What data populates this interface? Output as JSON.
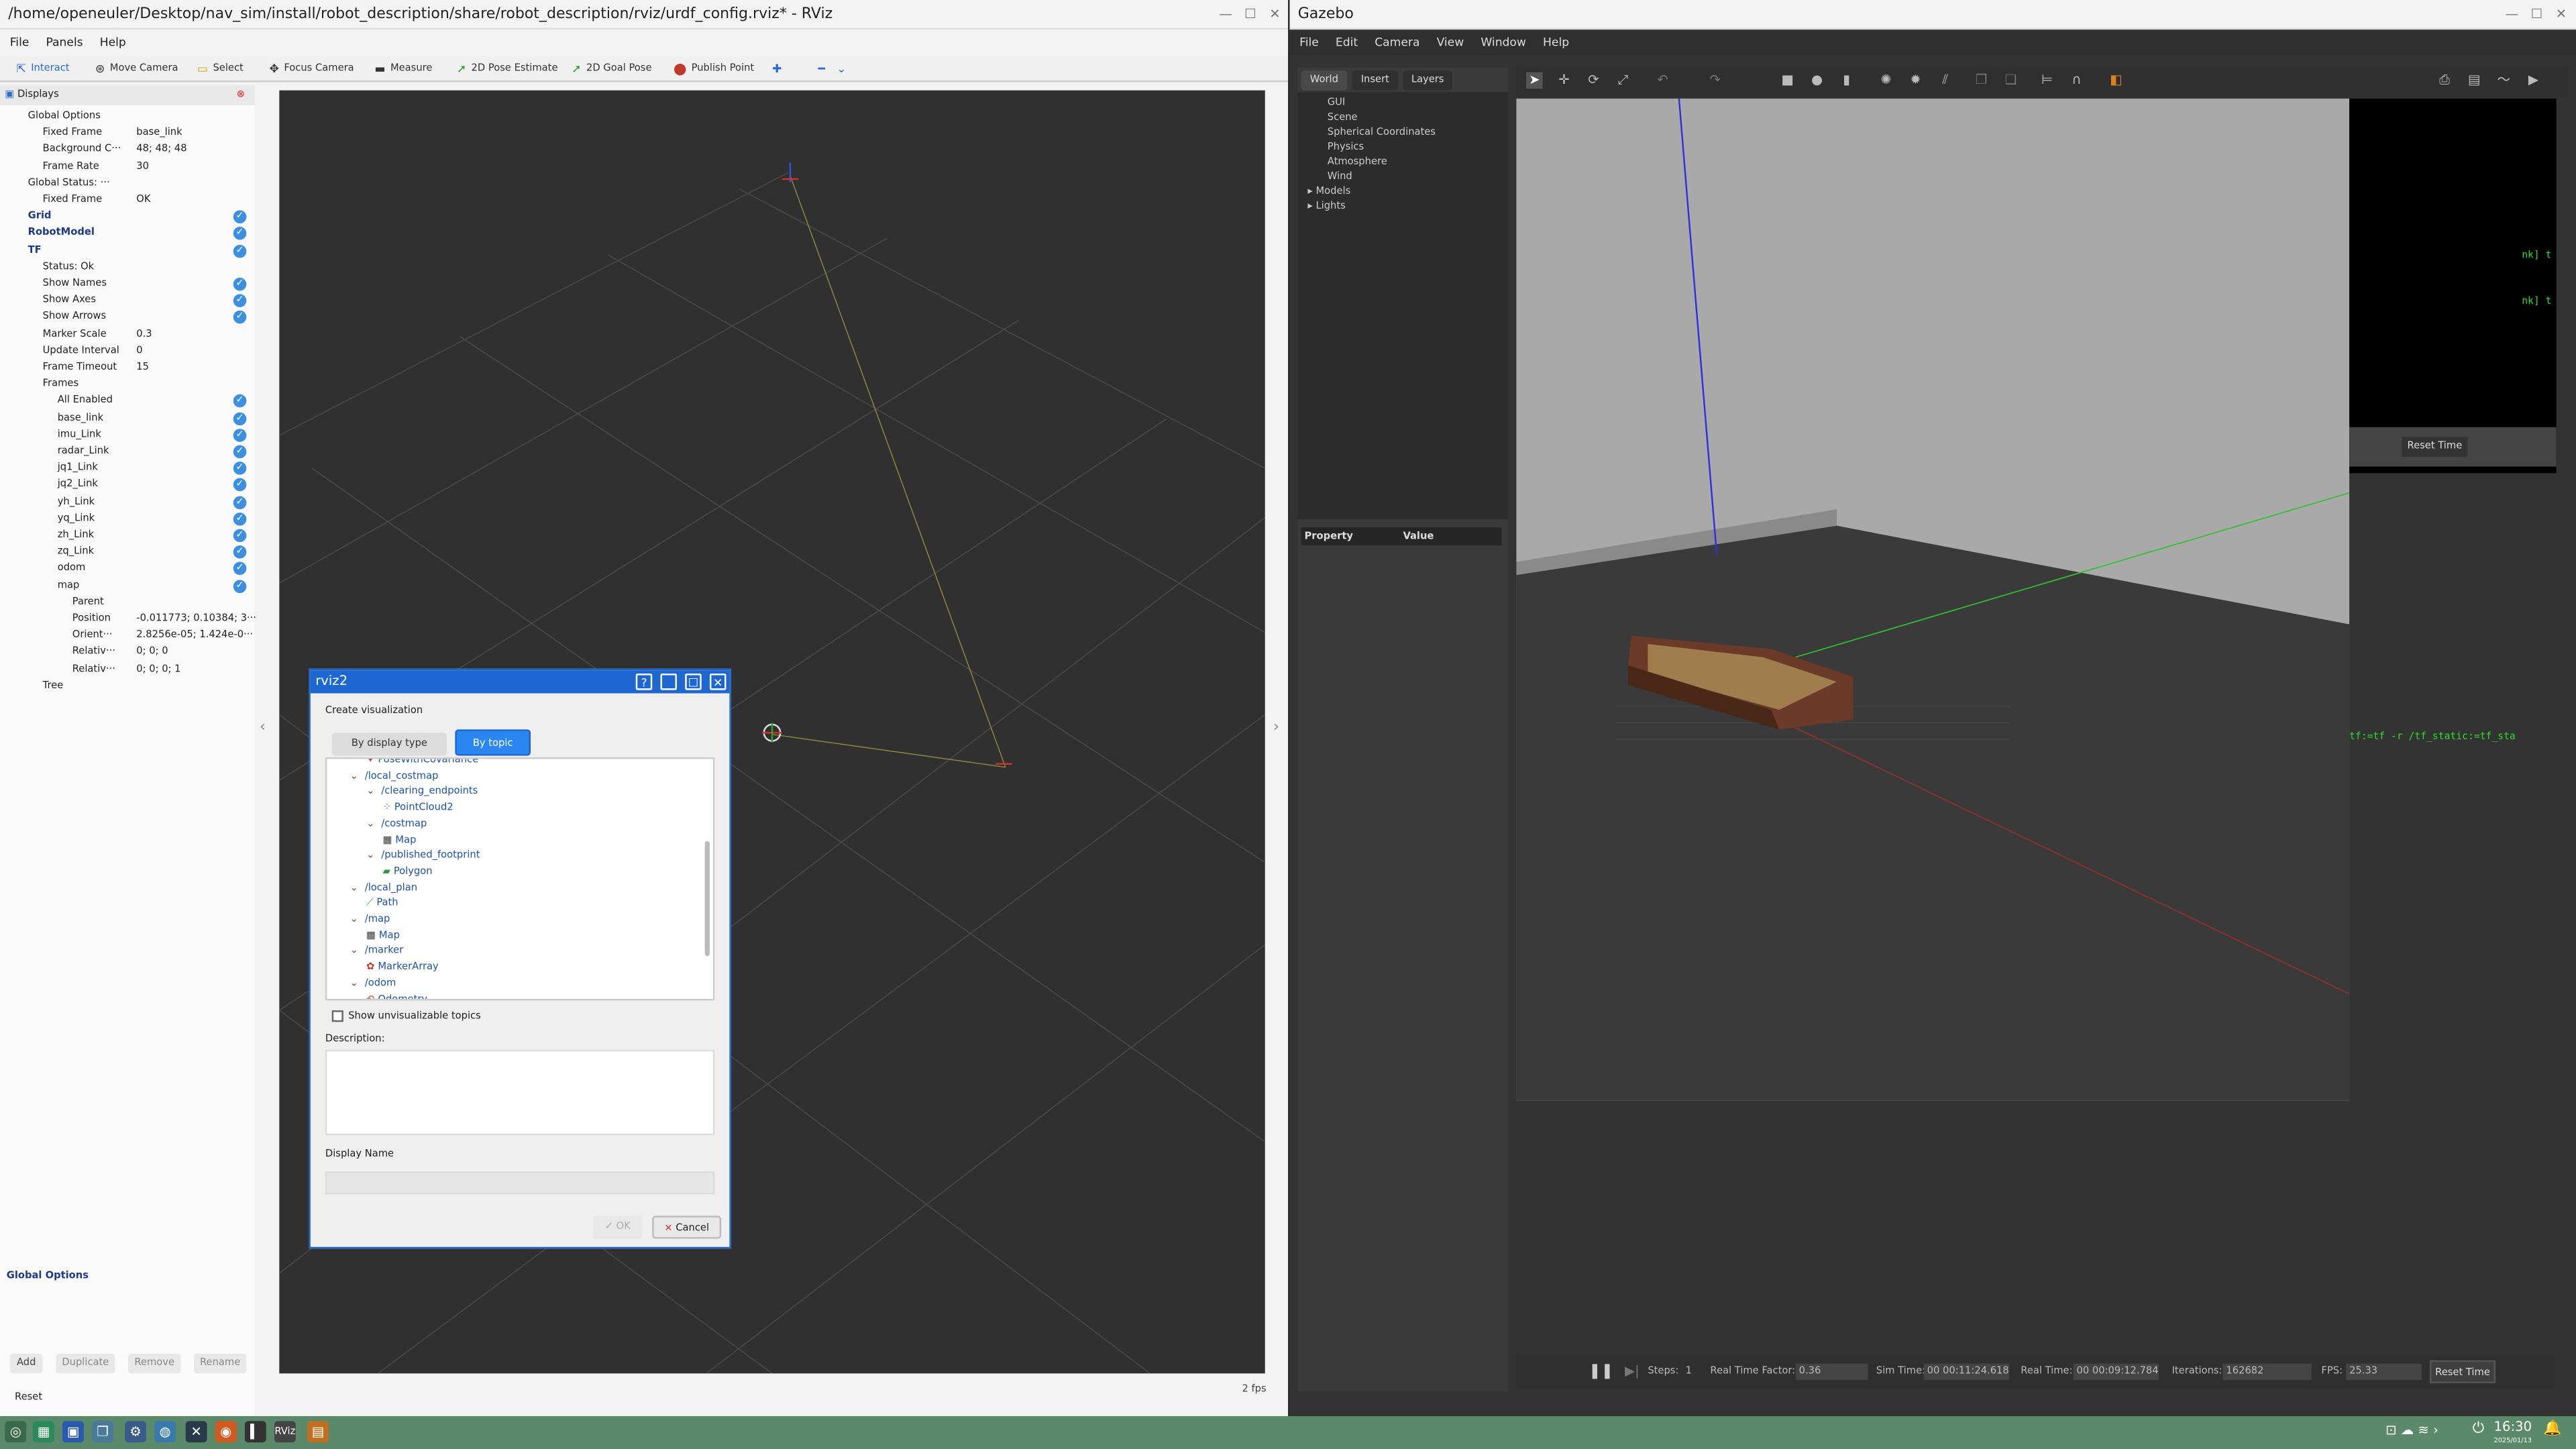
{
  "rviz": {
    "title": "/home/openeuler/Desktop/nav_sim/install/robot_description/share/robot_description/rviz/urdf_config.rviz* - RViz",
    "menu": [
      "File",
      "Panels",
      "Help"
    ],
    "toolbar": [
      "Interact",
      "Move Camera",
      "Select",
      "Focus Camera",
      "Measure",
      "2D Pose Estimate",
      "2D Goal Pose",
      "Publish Point"
    ],
    "displays_title": "Displays",
    "props": [
      {
        "label": "Global Options",
        "value": "",
        "indent": 1
      },
      {
        "label": "Fixed Frame",
        "value": "base_link",
        "indent": 2
      },
      {
        "label": "Background C···",
        "value": "48; 48; 48",
        "indent": 2
      },
      {
        "label": "Frame Rate",
        "value": "30",
        "indent": 2
      },
      {
        "label": "Global Status: ···",
        "value": "",
        "indent": 1
      },
      {
        "label": "Fixed Frame",
        "value": "OK",
        "indent": 2
      },
      {
        "label": "Grid",
        "value": "",
        "indent": 1
      },
      {
        "label": "RobotModel",
        "value": "",
        "indent": 1
      },
      {
        "label": "TF",
        "value": "",
        "indent": 1
      },
      {
        "label": "Status: Ok",
        "value": "",
        "indent": 2
      },
      {
        "label": "Show Names",
        "value": "",
        "indent": 2
      },
      {
        "label": "Show Axes",
        "value": "",
        "indent": 2
      },
      {
        "label": "Show Arrows",
        "value": "",
        "indent": 2
      },
      {
        "label": "Marker Scale",
        "value": "0.3",
        "indent": 2
      },
      {
        "label": "Update Interval",
        "value": "0",
        "indent": 2
      },
      {
        "label": "Frame Timeout",
        "value": "15",
        "indent": 2
      },
      {
        "label": "Frames",
        "value": "",
        "indent": 2
      },
      {
        "label": "All Enabled",
        "value": "",
        "indent": 3
      },
      {
        "label": "base_link",
        "value": "",
        "indent": 3
      },
      {
        "label": "imu_Link",
        "value": "",
        "indent": 3
      },
      {
        "label": "radar_Link",
        "value": "",
        "indent": 3
      },
      {
        "label": "jq1_Link",
        "value": "",
        "indent": 3
      },
      {
        "label": "jq2_Link",
        "value": "",
        "indent": 3
      },
      {
        "label": "yh_Link",
        "value": "",
        "indent": 3
      },
      {
        "label": "yq_Link",
        "value": "",
        "indent": 3
      },
      {
        "label": "zh_Link",
        "value": "",
        "indent": 3
      },
      {
        "label": "zq_Link",
        "value": "",
        "indent": 3
      },
      {
        "label": "odom",
        "value": "",
        "indent": 3
      },
      {
        "label": "map",
        "value": "",
        "indent": 3
      },
      {
        "label": "Parent",
        "value": "",
        "indent": 4
      },
      {
        "label": "Position",
        "value": "-0.011773; 0.10384; 3···",
        "indent": 4
      },
      {
        "label": "Orient···",
        "value": "2.8256e-05; 1.424e-0···",
        "indent": 4
      },
      {
        "label": "Relativ···",
        "value": "0; 0; 0",
        "indent": 4
      },
      {
        "label": "Relativ···",
        "value": "0; 0; 0; 1",
        "indent": 4
      },
      {
        "label": "Tree",
        "value": "",
        "indent": 2
      }
    ],
    "global_options_label": "Global Options",
    "buttons": [
      "Add",
      "Duplicate",
      "Remove",
      "Rename"
    ],
    "reset": "Reset",
    "fps": "2 fps"
  },
  "dialog": {
    "title": "rviz2",
    "heading": "Create visualization",
    "tab_type": "By display type",
    "tab_topic": "By topic",
    "tree": [
      {
        "t": "PoseWithCovariance",
        "lvl": 2,
        "ico": "✦",
        "c": "#b01a3c"
      },
      {
        "t": "/local_costmap",
        "lvl": 1,
        "ico": "",
        "c": ""
      },
      {
        "t": "/clearing_endpoints",
        "lvl": 2,
        "ico": "",
        "c": ""
      },
      {
        "t": "PointCloud2",
        "lvl": 3,
        "ico": "⁘",
        "c": "#3a70c8"
      },
      {
        "t": "/costmap",
        "lvl": 2,
        "ico": "",
        "c": ""
      },
      {
        "t": "Map",
        "lvl": 3,
        "ico": "▦",
        "c": "#333"
      },
      {
        "t": "/published_footprint",
        "lvl": 2,
        "ico": "",
        "c": ""
      },
      {
        "t": "Polygon",
        "lvl": 3,
        "ico": "▰",
        "c": "#2a9a3a"
      },
      {
        "t": "/local_plan",
        "lvl": 1,
        "ico": "",
        "c": ""
      },
      {
        "t": "Path",
        "lvl": 2,
        "ico": "⟋",
        "c": "#2a9a3a"
      },
      {
        "t": "/map",
        "lvl": 1,
        "ico": "",
        "c": ""
      },
      {
        "t": "Map",
        "lvl": 2,
        "ico": "▦",
        "c": "#333"
      },
      {
        "t": "/marker",
        "lvl": 1,
        "ico": "",
        "c": ""
      },
      {
        "t": "MarkerArray",
        "lvl": 2,
        "ico": "✿",
        "c": "#c0392b"
      },
      {
        "t": "/odom",
        "lvl": 1,
        "ico": "",
        "c": ""
      },
      {
        "t": "Odometry",
        "lvl": 2,
        "ico": "↶",
        "c": "#c0392b"
      }
    ],
    "show_unvis": "Show unvisualizable topics",
    "description_label": "Description:",
    "display_name_label": "Display Name",
    "ok": "OK",
    "cancel": "Cancel"
  },
  "gazebo": {
    "title": "Gazebo",
    "menu": [
      "File",
      "Edit",
      "Camera",
      "View",
      "Window",
      "Help"
    ],
    "tabs": [
      "World",
      "Insert",
      "Layers"
    ],
    "world_items": [
      "GUI",
      "Scene",
      "Spherical Coordinates",
      "Physics",
      "Atmosphere",
      "Wind"
    ],
    "world_expand": [
      "Models",
      "Lights"
    ],
    "prop_header": "Property",
    "value_header": "Value",
    "terminal_lines": [
      "nk] t",
      "nk] t",
      "tf:=tf -r /tf_static:=tf_sta"
    ],
    "reset_time_top": "Reset Time",
    "status": {
      "steps_label": "Steps:",
      "steps": "1",
      "rtf_label": "Real Time Factor:",
      "rtf": "0.36",
      "sim_label": "Sim Time:",
      "sim": "00 00:11:24.618",
      "real_label": "Real Time:",
      "real": "00 00:09:12.784",
      "iter_label": "Iterations:",
      "iter": "162682",
      "fps_label": "FPS:",
      "fps": "25.33",
      "reset": "Reset Time"
    }
  },
  "taskbar": {
    "time": "16:30",
    "date": "2025/01/13"
  }
}
